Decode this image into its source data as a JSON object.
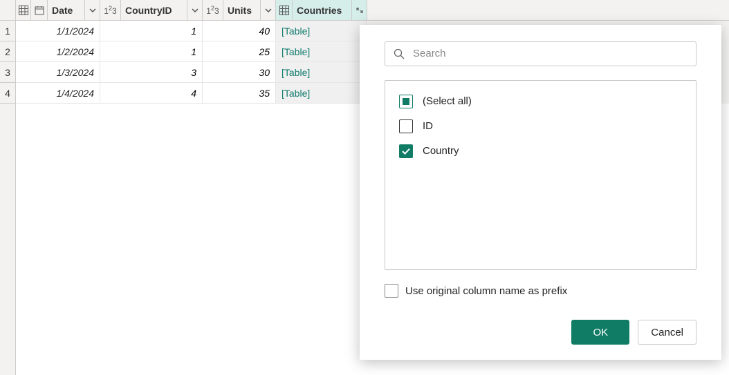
{
  "columns": {
    "date": "Date",
    "countryId": "CountryID",
    "units": "Units",
    "countries": "Countries"
  },
  "rows": [
    {
      "n": "1",
      "date": "1/1/2024",
      "cid": "1",
      "units": "40",
      "countries": "[Table]"
    },
    {
      "n": "2",
      "date": "1/2/2024",
      "cid": "1",
      "units": "25",
      "countries": "[Table]"
    },
    {
      "n": "3",
      "date": "1/3/2024",
      "cid": "3",
      "units": "30",
      "countries": "[Table]"
    },
    {
      "n": "4",
      "date": "1/4/2024",
      "cid": "4",
      "units": "35",
      "countries": "[Table]"
    }
  ],
  "popup": {
    "searchPlaceholder": "Search",
    "selectAll": "(Select all)",
    "fields": [
      {
        "label": "ID",
        "checked": false
      },
      {
        "label": "Country",
        "checked": true
      }
    ],
    "prefixLabel": "Use original column name as prefix",
    "okLabel": "OK",
    "cancelLabel": "Cancel"
  }
}
